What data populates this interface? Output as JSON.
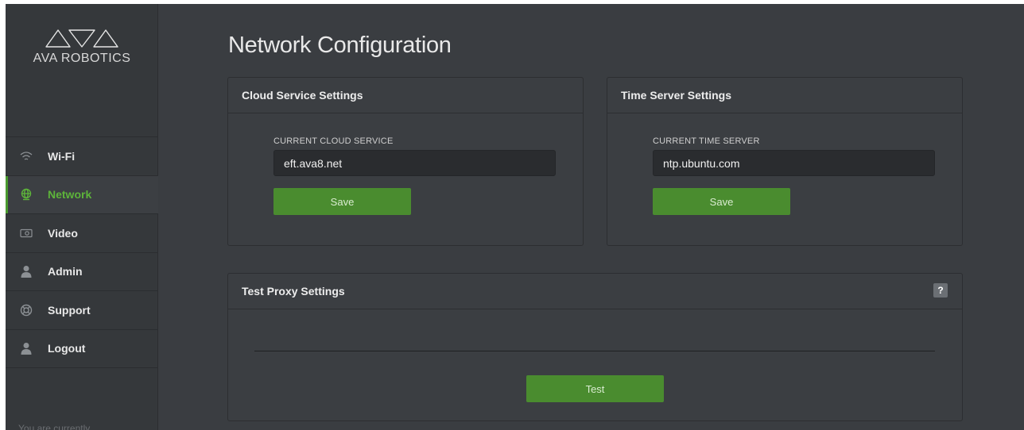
{
  "brand": {
    "name": "AVA ROBOTICS"
  },
  "nav": [
    {
      "label": "Wi-Fi",
      "icon": "wifi-icon",
      "active": false
    },
    {
      "label": "Network",
      "icon": "globe-icon",
      "active": true
    },
    {
      "label": "Video",
      "icon": "video-icon",
      "active": false
    },
    {
      "label": "Admin",
      "icon": "user-icon",
      "active": false
    },
    {
      "label": "Support",
      "icon": "lifebuoy-icon",
      "active": false
    },
    {
      "label": "Logout",
      "icon": "user-icon",
      "active": false
    }
  ],
  "sidebar_footer": "You are currently ...",
  "page_title": "Network Configuration",
  "cloud": {
    "heading": "Cloud Service Settings",
    "field_label": "CURRENT CLOUD SERVICE",
    "value": "eft.ava8.net",
    "save_label": "Save"
  },
  "time": {
    "heading": "Time Server Settings",
    "field_label": "CURRENT TIME SERVER",
    "value": "ntp.ubuntu.com",
    "save_label": "Save"
  },
  "proxy": {
    "heading": "Test Proxy Settings",
    "help_label": "?",
    "test_label": "Test"
  },
  "colors": {
    "accent_green": "#4a8c2f",
    "active_text": "#5db43a",
    "background": "#3a3d41",
    "sidebar": "#35383b"
  }
}
